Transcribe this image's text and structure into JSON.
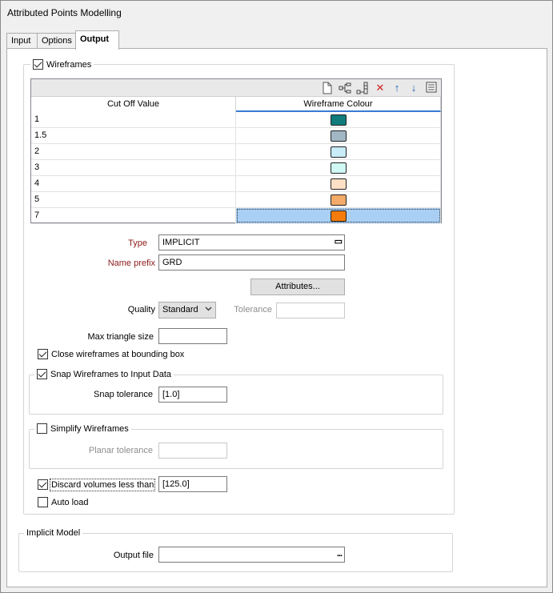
{
  "window": {
    "title": "Attributed Points Modelling"
  },
  "tabs": [
    {
      "label": "Input",
      "active": false
    },
    {
      "label": "Options",
      "active": false
    },
    {
      "label": "Output",
      "active": true
    }
  ],
  "wireframes": {
    "label": "Wireframes",
    "checked": true,
    "toolbar_icons": [
      "new-document-icon",
      "insert-row-icon",
      "add-row-icon",
      "delete-icon",
      "move-up-icon",
      "move-down-icon",
      "list-icon"
    ],
    "table": {
      "columns": [
        "Cut Off Value",
        "Wireframe Colour"
      ],
      "rows": [
        {
          "value": "1",
          "colour": "#127c7c"
        },
        {
          "value": "1.5",
          "colour": "#a1b8c4"
        },
        {
          "value": "2",
          "colour": "#c8ecf8"
        },
        {
          "value": "3",
          "colour": "#d0f8f5"
        },
        {
          "value": "4",
          "colour": "#fde0c6"
        },
        {
          "value": "5",
          "colour": "#f2ab68"
        },
        {
          "value": "7",
          "colour": "#f57c0c",
          "selected": true
        }
      ]
    },
    "type": {
      "label": "Type",
      "value": "IMPLICIT"
    },
    "name_prefix": {
      "label": "Name prefix",
      "value": "GRD"
    },
    "attributes_button": "Attributes...",
    "quality": {
      "label": "Quality",
      "value": "Standard"
    },
    "tolerance": {
      "label": "Tolerance",
      "value": ""
    },
    "max_triangle": {
      "label": "Max triangle size",
      "value": ""
    },
    "close_at_bbox": {
      "label": "Close wireframes at bounding box",
      "checked": true
    },
    "snap": {
      "label": "Snap Wireframes to Input Data",
      "checked": true,
      "tolerance_label": "Snap tolerance",
      "tolerance_value": "[1.0]"
    },
    "simplify": {
      "label": "Simplify Wireframes",
      "checked": false,
      "planar_label": "Planar tolerance",
      "planar_value": ""
    },
    "discard": {
      "label": "Discard volumes less than",
      "checked": true,
      "value": "[125.0]"
    },
    "auto_load": {
      "label": "Auto load",
      "checked": false
    }
  },
  "implicit_model": {
    "label": "Implicit Model",
    "output_file_label": "Output file",
    "output_file_value": ""
  }
}
